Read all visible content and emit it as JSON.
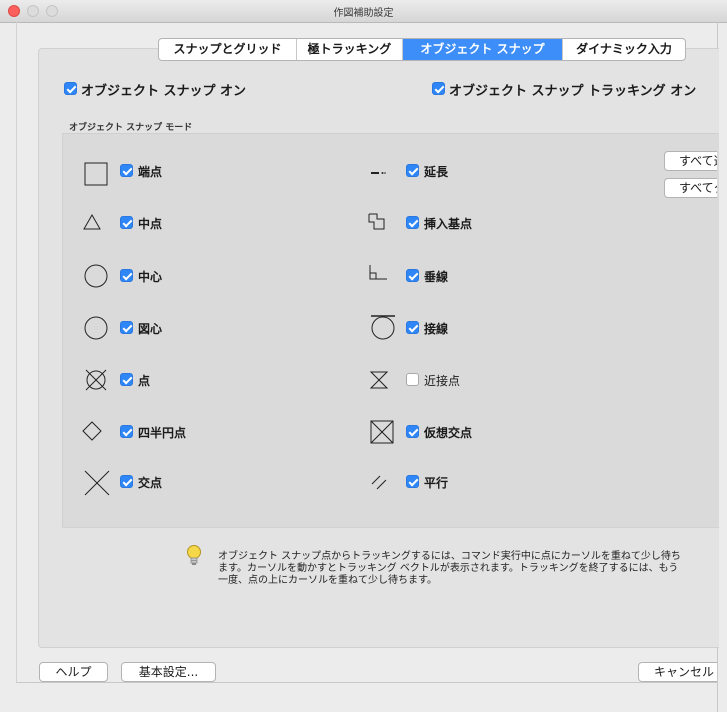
{
  "window": {
    "title": "作図補助設定"
  },
  "tabs": [
    {
      "label": "スナップとグリッド",
      "active": false
    },
    {
      "label": "極トラッキング",
      "active": false
    },
    {
      "label": "オブジェクト スナップ",
      "active": true
    },
    {
      "label": "ダイナミック入力",
      "active": false
    }
  ],
  "osnap_on": {
    "label": "オブジェクト スナップ オン",
    "checked": true
  },
  "osnap_tracking_on": {
    "label": "オブジェクト スナップ トラッキング オン",
    "checked": true
  },
  "modes_header": "オブジェクト スナップ モード",
  "modes_left": [
    {
      "label": "端点",
      "icon": "square-icon",
      "checked": true
    },
    {
      "label": "中点",
      "icon": "triangle-icon",
      "checked": true
    },
    {
      "label": "中心",
      "icon": "circle-icon",
      "checked": true
    },
    {
      "label": "図心",
      "icon": "circle-icon",
      "checked": true
    },
    {
      "label": "点",
      "icon": "circle-x-icon",
      "checked": true
    },
    {
      "label": "四半円点",
      "icon": "diamond-icon",
      "checked": true
    },
    {
      "label": "交点",
      "icon": "x-icon",
      "checked": true
    }
  ],
  "modes_right": [
    {
      "label": "延長",
      "icon": "extension-icon",
      "checked": true
    },
    {
      "label": "挿入基点",
      "icon": "insertion-icon",
      "checked": true
    },
    {
      "label": "垂線",
      "icon": "perpendicular-icon",
      "checked": true
    },
    {
      "label": "接線",
      "icon": "tangent-icon",
      "checked": true
    },
    {
      "label": "近接点",
      "icon": "nearest-icon",
      "checked": false
    },
    {
      "label": "仮想交点",
      "icon": "apparent-intersection-icon",
      "checked": true
    },
    {
      "label": "平行",
      "icon": "parallel-icon",
      "checked": true
    }
  ],
  "select_all_label": "すべて選",
  "clear_all_label": "すべてク",
  "hint": {
    "icon": "lightbulb-icon",
    "text": "オブジェクト スナップ点からトラッキングするには、コマンド実行中に点にカーソルを重ねて少し待ちます。カーソルを動かすとトラッキング ベクトルが表示されます。トラッキングを終了するには、もう一度、点の上にカーソルを重ねて少し待ちます。"
  },
  "buttons": {
    "help": "ヘルプ",
    "preferences": "基本設定...",
    "cancel": "キャンセル"
  }
}
